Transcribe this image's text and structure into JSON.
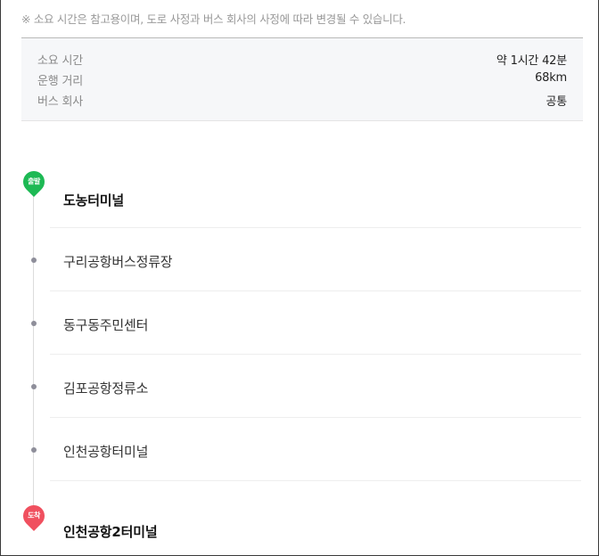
{
  "notice": "※ 소요 시간은 참고용이며, 도로 사정과 버스 회사의 사정에 따라 변경될 수 있습니다.",
  "info": [
    {
      "key": "소요 시간",
      "value": "약 1시간 42분"
    },
    {
      "key": "운행 거리",
      "value": "68km"
    },
    {
      "key": "버스 회사",
      "value": "공통"
    }
  ],
  "route": {
    "start_badge": "출발",
    "end_badge": "도착",
    "start": "도농터미널",
    "stops": [
      "구리공항버스정류장",
      "동구동주민센터",
      "김포공항정류소",
      "인천공항터미널"
    ],
    "end": "인천공항2터미널"
  },
  "colors": {
    "start_pin": "#1db954",
    "end_pin": "#f0505f",
    "stop_dot": "#8e8e9a"
  },
  "icons": {
    "start": "start-pin-icon",
    "end": "end-pin-icon",
    "stop": "stop-dot-icon"
  }
}
